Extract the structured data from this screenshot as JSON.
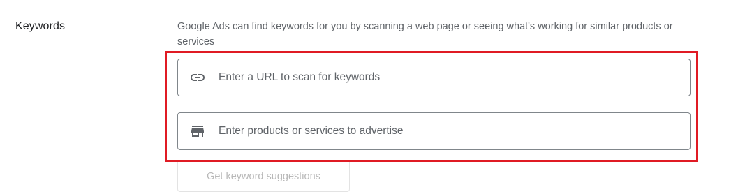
{
  "section": {
    "label": "Keywords",
    "description": "Google Ads can find keywords for you by scanning a web page or seeing what's working for similar products or services"
  },
  "url_field": {
    "icon": "link-icon",
    "placeholder": "Enter a URL to scan for keywords",
    "value": ""
  },
  "products_field": {
    "icon": "storefront-icon",
    "placeholder": "Enter products or services to advertise",
    "value": ""
  },
  "suggest_button": {
    "label": "Get keyword suggestions",
    "enabled": false
  },
  "colors": {
    "highlight": "#e01b24",
    "text_primary": "#202124",
    "text_secondary": "#5f6368",
    "field_border": "#80868b",
    "disabled_text": "#b8b8b8"
  }
}
